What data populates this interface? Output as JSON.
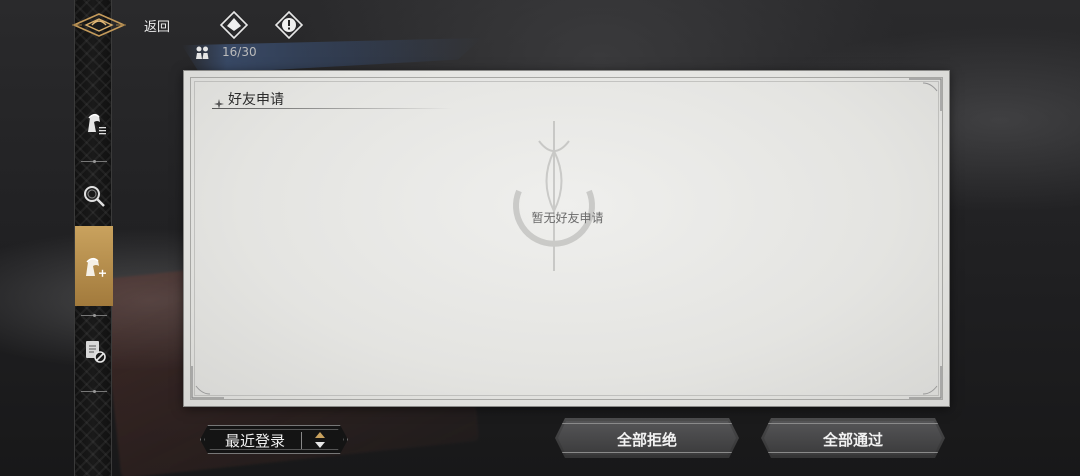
{
  "header": {
    "back_label": "返回",
    "friend_count": "16/30"
  },
  "sidebar": {
    "items": [
      {
        "name": "friends-list",
        "icon": "character-list-icon",
        "active": false
      },
      {
        "name": "search",
        "icon": "magnifier-icon",
        "active": false
      },
      {
        "name": "friend-requests",
        "icon": "character-add-icon",
        "active": true
      },
      {
        "name": "blacklist",
        "icon": "scroll-block-icon",
        "active": false
      }
    ]
  },
  "panel": {
    "title": "好友申请",
    "empty_text": "暂无好友申请"
  },
  "footer": {
    "sort_label": "最近登录",
    "reject_all_label": "全部拒绝",
    "accept_all_label": "全部通过"
  },
  "colors": {
    "active_tab": "#b88f4c",
    "panel_bg": "#e8e8e5",
    "button_bg": "#444446"
  }
}
